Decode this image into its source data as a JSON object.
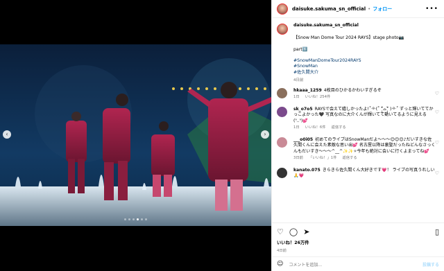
{
  "post": {
    "username": "daisuke.sakuma_sn_official",
    "follow_label": "フォロー",
    "separator": "•",
    "more_icon": "ellipsis-icon",
    "caption_lines": [
      "【Snow Man Dome Tour 2024 RAYS】stage photo📷",
      "",
      "part1️⃣",
      "",
      "#SnowManDomeTour2024RAYS",
      "#SnowMan",
      "#佐久間大介"
    ],
    "caption_time": "4日前",
    "likes": "いいね！26万件",
    "time": "4日前",
    "add_comment_placeholder": "コメントを追加...",
    "post_button": "投稿する",
    "carousel": {
      "slide_count": 6,
      "active_index": 3
    }
  },
  "comments": [
    {
      "user": "hkaaa_1259",
      "text": "4枚目のひかるかわいすぎるぞ",
      "time": "1日",
      "likes": "いいね！254件",
      "reply": "",
      "avatar_color": "#8a6f5c"
    },
    {
      "user": "sk_o7o5",
      "text": "RAYSで会えて嬉しかったよ!˚‧º·(˚ ˃̣̣̥᷄⌓˂̣̣̥᷅ )‧º·˚ ずっと輝いててかっこよかった🖤 写真なのに大介くんが輝いてて動いてるように見える(ᐢ..ᐢ)💕",
      "time": "1日",
      "likes": "いいね！6件",
      "reply": "返信する",
      "avatar_color": "#7b4a8c"
    },
    {
      "user": "___o0i05",
      "text": "初めてのライブはSnowManだよ〜〜〜😊😊😊♪だいすきな佐久間くんに会えた素敵な思い出💕 名古屋以降は裏聖だったねどんなさっくんもだいすき〜〜〜^__^✨✨✧今年も絶対に会いに行くよまってね💕",
      "time": "3日前",
      "likes": "「いいね！」1件",
      "reply": "返信する",
      "avatar_color": "#c98a96"
    },
    {
      "user": "kanato.075",
      "text": "きらきら佐久間くん大好きです💗！ ライブの写真うれしい🙏💗",
      "time": "",
      "likes": "",
      "reply": "",
      "avatar_color": "#333333"
    }
  ],
  "icons": {
    "like": "heart-icon",
    "comment": "comment-icon",
    "share": "share-icon",
    "save": "bookmark-icon",
    "emoji": "smiley-icon"
  }
}
